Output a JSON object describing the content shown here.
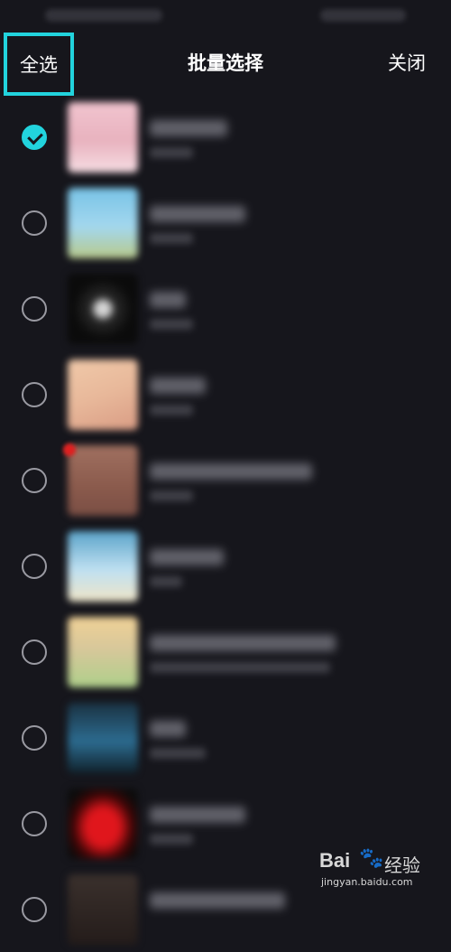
{
  "header": {
    "select_all": "全选",
    "title": "批量选择",
    "close": "关闭",
    "highlight_color": "#22d3dd"
  },
  "list": {
    "items": [
      {
        "checked": true
      },
      {
        "checked": false
      },
      {
        "checked": false
      },
      {
        "checked": false
      },
      {
        "checked": false
      },
      {
        "checked": false
      },
      {
        "checked": false
      },
      {
        "checked": false
      },
      {
        "checked": false
      },
      {
        "checked": false
      }
    ]
  },
  "watermark": {
    "brand": "Bai",
    "brand_suffix": "经验",
    "url": "jingyan.baidu.com"
  }
}
